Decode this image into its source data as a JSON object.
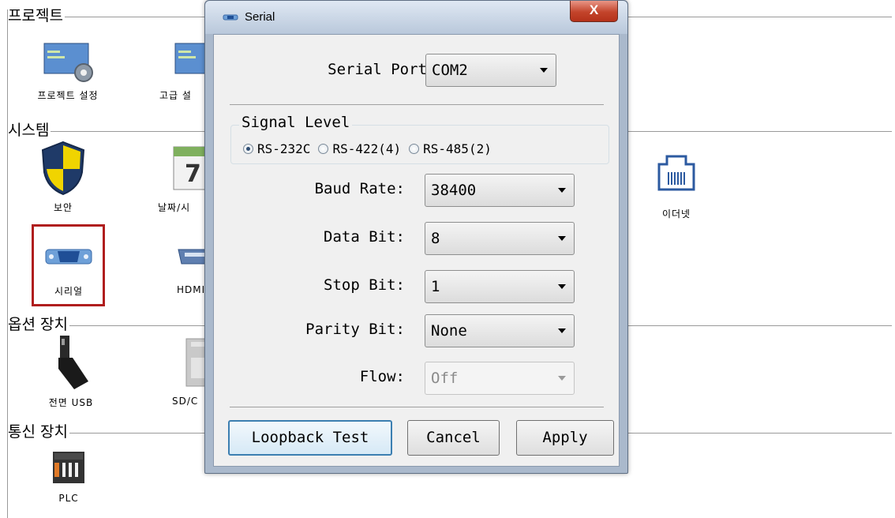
{
  "panel": {
    "sections": [
      "프로젝트",
      "시스템",
      "옵션 장치",
      "통신 장치"
    ],
    "items": {
      "project_settings": "프로젝트 설정",
      "advanced_settings": "고급 설",
      "security": "보안",
      "date_time": "날짜/시",
      "ethernet": "이더넷",
      "serial": "시리얼",
      "hdmi": "HDMI",
      "front_usb": "전면 USB",
      "sd_card": "SD/C",
      "plc": "PLC"
    },
    "calendar_digit": "7"
  },
  "dialog": {
    "title": "Serial",
    "close_glyph": "X",
    "serial_port_label": "Serial Port",
    "serial_port_value": "COM2",
    "signal_level_title": "Signal Level",
    "signal_options": [
      {
        "label": "RS-232C",
        "checked": true
      },
      {
        "label": "RS-422(4)",
        "checked": false
      },
      {
        "label": "RS-485(2)",
        "checked": false
      }
    ],
    "fields": [
      {
        "label": "Baud Rate:",
        "value": "38400",
        "enabled": true
      },
      {
        "label": "Data Bit:",
        "value": "8",
        "enabled": true
      },
      {
        "label": "Stop Bit:",
        "value": "1",
        "enabled": true
      },
      {
        "label": "Parity Bit:",
        "value": "None",
        "enabled": true
      },
      {
        "label": "Flow:",
        "value": "Off",
        "enabled": false
      }
    ],
    "buttons": {
      "loopback": "Loopback Test",
      "cancel": "Cancel",
      "apply": "Apply"
    }
  },
  "colors": {
    "highlight": "#b01e1e",
    "dialog_frame": "#aab9cc",
    "close_button": "#c3442b"
  }
}
